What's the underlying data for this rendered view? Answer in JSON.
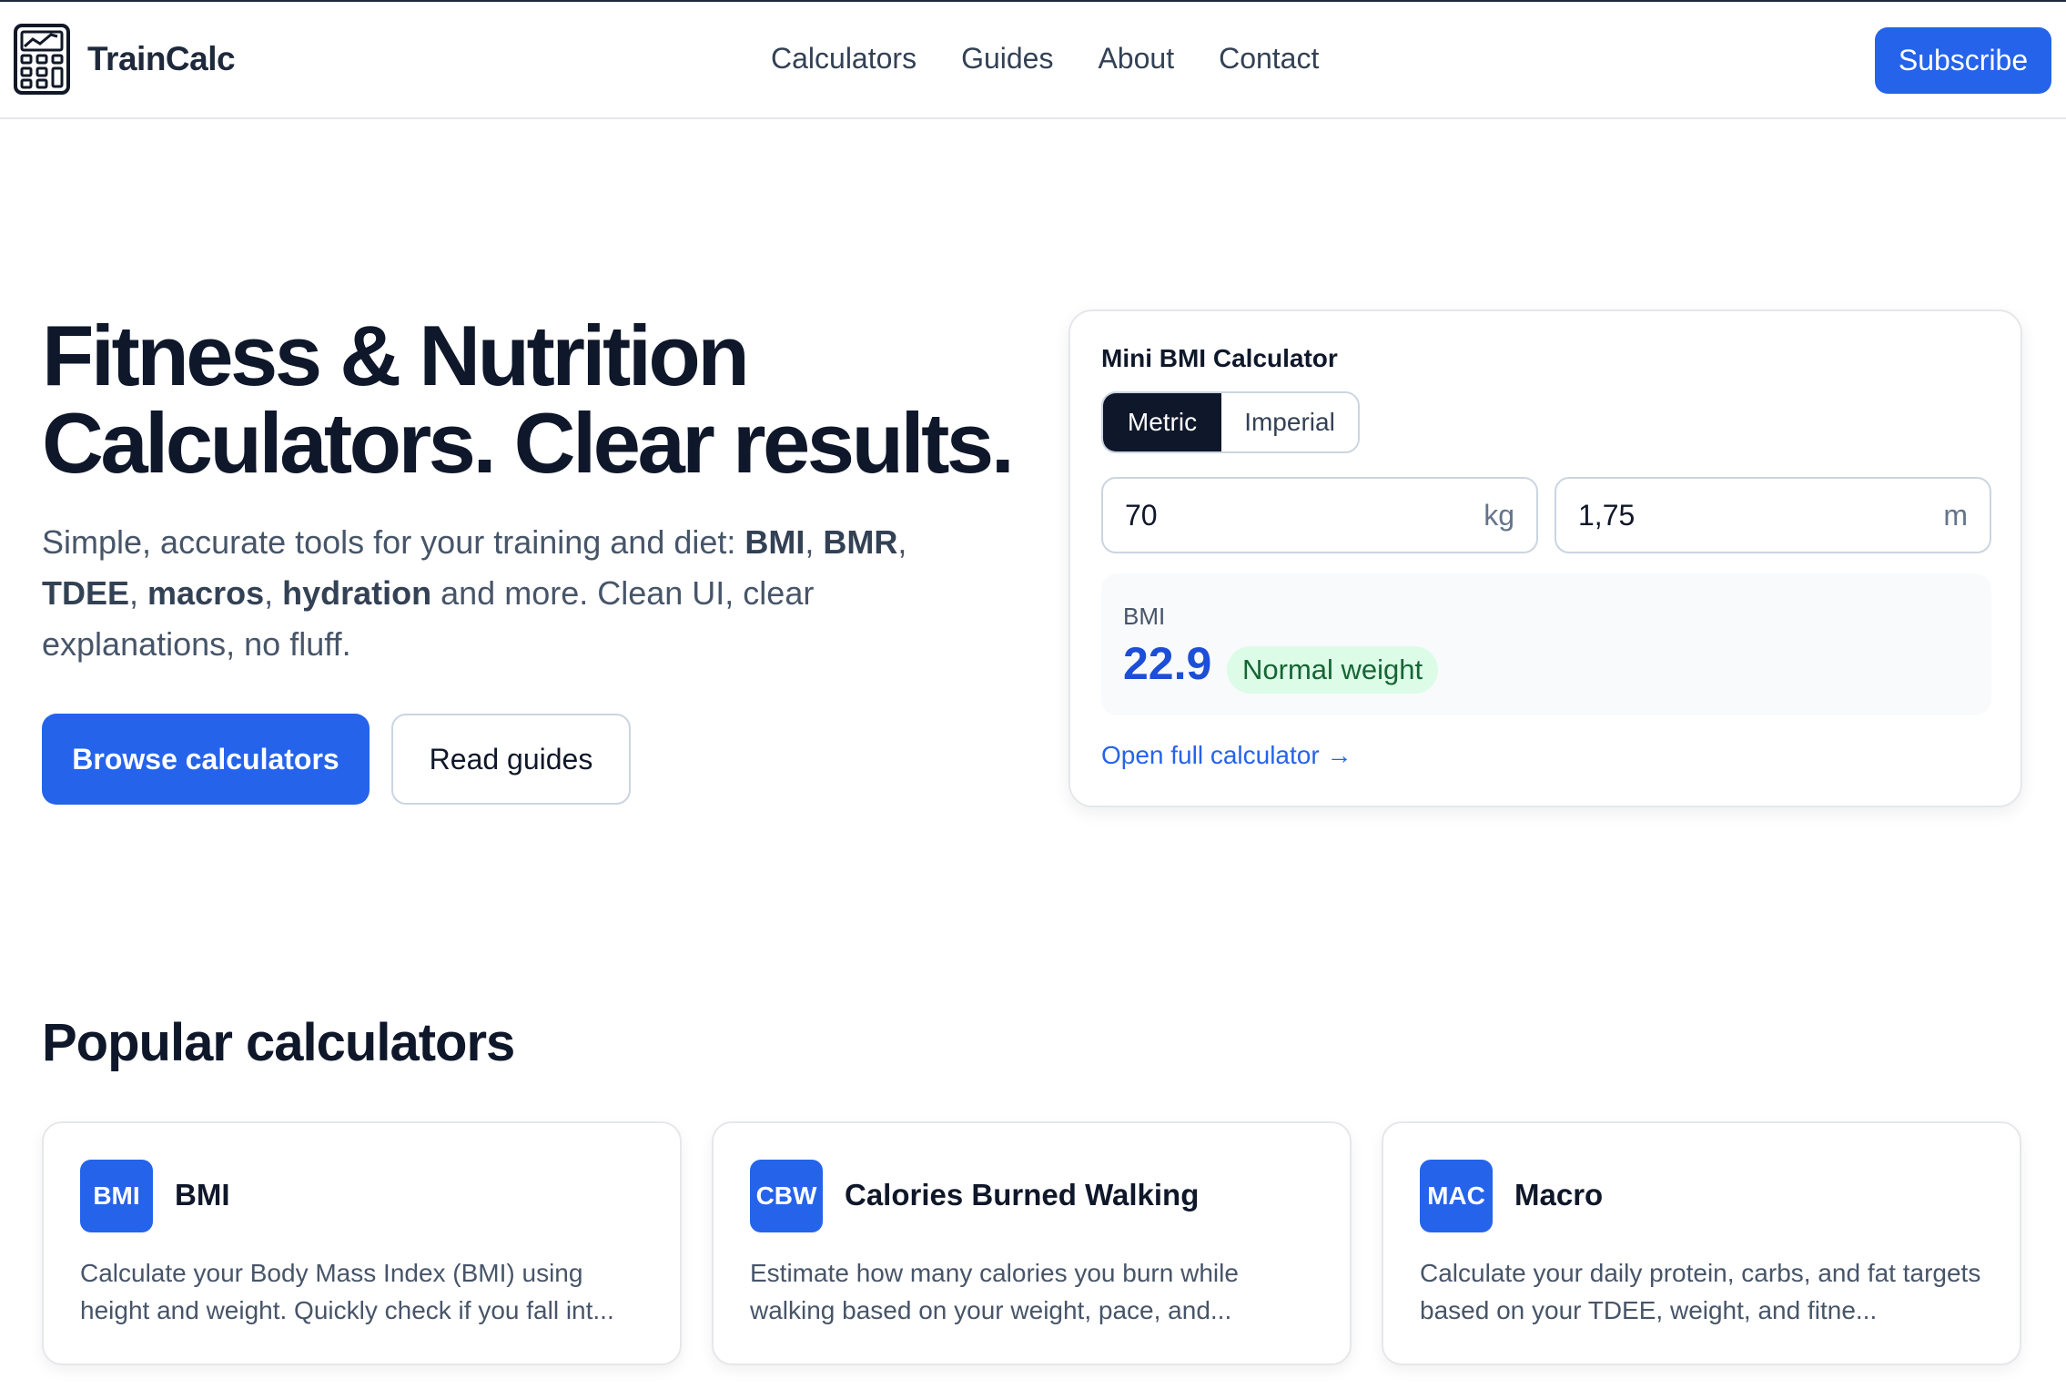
{
  "brand": {
    "name": "TrainCalc",
    "logo_icon": "calculator-chart-icon"
  },
  "nav": {
    "items": [
      "Calculators",
      "Guides",
      "About",
      "Contact"
    ]
  },
  "header": {
    "subscribe_label": "Subscribe"
  },
  "hero": {
    "title_line1": "Fitness & Nutrition",
    "title_line2": "Calculators. Clear results.",
    "subtitle_parts": [
      "Simple, accurate tools for your training and diet: ",
      "BMI",
      ", ",
      "BMR",
      ", ",
      "TDEE",
      ", ",
      "macros",
      ", ",
      "hydration",
      " and more. Clean UI, clear explanations, no fluff."
    ],
    "primary_cta": "Browse calculators",
    "secondary_cta": "Read guides"
  },
  "mini_bmi": {
    "title": "Mini BMI Calculator",
    "units": {
      "active": "Metric",
      "inactive": "Imperial"
    },
    "weight": {
      "value": "70",
      "unit": "kg"
    },
    "height": {
      "value": "1,75",
      "unit": "m"
    },
    "result_label": "BMI",
    "result_value": "22.9",
    "result_category": "Normal weight",
    "link_label": "Open full calculator →"
  },
  "popular": {
    "title": "Popular calculators",
    "cards": [
      {
        "badge": "BMI",
        "title": "BMI",
        "description": "Calculate your Body Mass Index (BMI) using height and weight. Quickly check if you fall int..."
      },
      {
        "badge": "CBW",
        "title": "Calories Burned Walking",
        "description": "Estimate how many calories you burn while walking based on your weight, pace, and..."
      },
      {
        "badge": "MAC",
        "title": "Macro",
        "description": "Calculate your daily protein, carbs, and fat targets based on your TDEE, weight, and fitne..."
      }
    ]
  },
  "colors": {
    "accent": "#2563eb",
    "text_dark": "#0f172a",
    "text_muted": "#475569",
    "badge_success_bg": "#dcfce7",
    "badge_success_text": "#166534"
  }
}
